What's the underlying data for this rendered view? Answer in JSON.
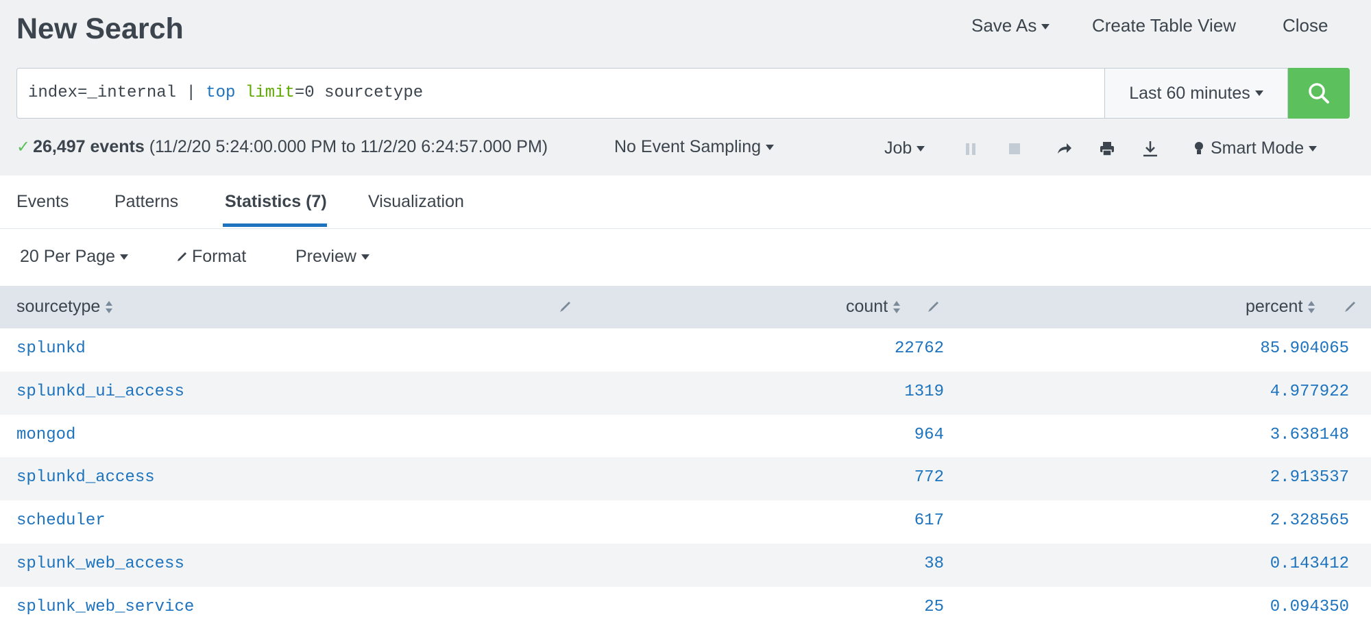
{
  "header": {
    "title": "New Search",
    "save_as": "Save As",
    "create_table_view": "Create Table View",
    "close": "Close"
  },
  "search": {
    "query": {
      "part1": "index=_internal ",
      "pipe": "|",
      "space1": " ",
      "cmd": "top",
      "space2": " ",
      "arg": "limit",
      "rest": "=0 sourcetype"
    },
    "time_range": "Last 60 minutes"
  },
  "status": {
    "event_count": "26,497 events",
    "range": "(11/2/20 5:24:00.000 PM to 11/2/20 6:24:57.000 PM)",
    "sampling": "No Event Sampling",
    "job": "Job",
    "mode": "Smart Mode"
  },
  "tabs": [
    {
      "label": "Events"
    },
    {
      "label": "Patterns"
    },
    {
      "label": "Statistics (7)"
    },
    {
      "label": "Visualization"
    }
  ],
  "toolbar": {
    "per_page": "20 Per Page",
    "format": "Format",
    "preview": "Preview"
  },
  "table": {
    "columns": [
      "sourcetype",
      "count",
      "percent"
    ],
    "rows": [
      {
        "sourcetype": "splunkd",
        "count": "22762",
        "percent": "85.904065"
      },
      {
        "sourcetype": "splunkd_ui_access",
        "count": "1319",
        "percent": "4.977922"
      },
      {
        "sourcetype": "mongod",
        "count": "964",
        "percent": "3.638148"
      },
      {
        "sourcetype": "splunkd_access",
        "count": "772",
        "percent": "2.913537"
      },
      {
        "sourcetype": "scheduler",
        "count": "617",
        "percent": "2.328565"
      },
      {
        "sourcetype": "splunk_web_access",
        "count": "38",
        "percent": "0.143412"
      },
      {
        "sourcetype": "splunk_web_service",
        "count": "25",
        "percent": "0.094350"
      }
    ]
  },
  "colors": {
    "accent": "#1e73be",
    "search_button": "#5cc05c",
    "success": "#5cc05c"
  },
  "icons": [
    "search-icon",
    "check-icon",
    "pause-icon",
    "stop-icon",
    "share-icon",
    "print-icon",
    "export-icon",
    "lightbulb-icon",
    "pencil-icon",
    "sort-icon"
  ]
}
